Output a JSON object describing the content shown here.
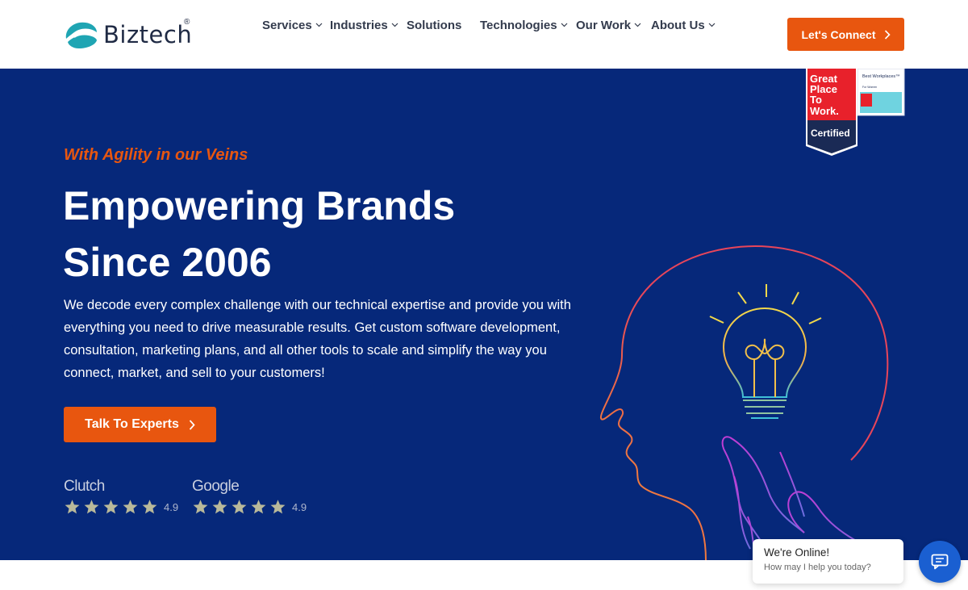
{
  "brand": {
    "name": "Biztech",
    "registered": "®",
    "colors": {
      "accent": "#e8560f",
      "hero_bg": "#06287a",
      "logo_teal": "#1fa5b3"
    }
  },
  "nav": {
    "items": [
      {
        "label": "Services",
        "has_dropdown": true
      },
      {
        "label": "Industries",
        "has_dropdown": true
      },
      {
        "label": "Solutions",
        "has_dropdown": false
      },
      {
        "label": "Technologies",
        "has_dropdown": true
      },
      {
        "label": "Our Work",
        "has_dropdown": true
      },
      {
        "label": "About Us",
        "has_dropdown": true
      }
    ],
    "cta_label": "Let's Connect"
  },
  "badge": {
    "line1": "Great",
    "line2": "Place",
    "line3": "To",
    "line4": "Work.",
    "certified": "Certified",
    "side_title": "Best Workplaces™",
    "side_sub": "For Women"
  },
  "hero": {
    "tagline": "With Agility in our Veins",
    "headline_line1": "Empowering Brands",
    "headline_line2": "Since 2006",
    "description": "We decode every complex challenge with our technical expertise and provide you with everything you need to drive measurable results. Get custom software development, consultation, marketing plans, and all other tools to scale and simplify the way you connect, market, and sell to your customers!",
    "cta_label": "Talk To Experts"
  },
  "ratings": [
    {
      "name": "Clutch",
      "stars": 5,
      "value": "4.9"
    },
    {
      "name": "Google",
      "stars": 5,
      "value": "4.9"
    }
  ],
  "chat": {
    "title": "We're Online!",
    "subtitle": "How may I help you today?",
    "icon": "chat-icon"
  }
}
